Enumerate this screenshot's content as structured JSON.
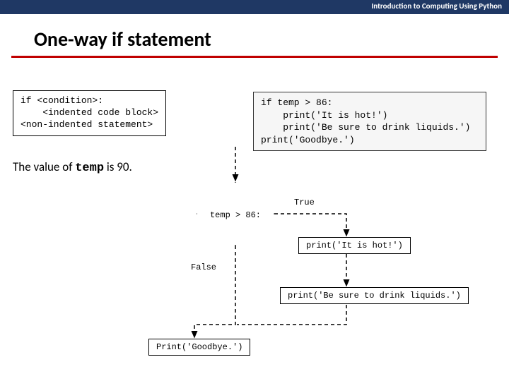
{
  "header": {
    "course": "Introduction to Computing Using Python"
  },
  "title": "One-way if statement",
  "syntax_box": "if <condition>:\n    <indented code block>\n<non-indented statement>",
  "code_box": "if temp > 86:\n    print('It is hot!')\n    print('Be sure to drink liquids.')\nprint('Goodbye.')",
  "value_sentence": {
    "prefix": "The value of ",
    "var": "temp",
    "suffix": " is 90."
  },
  "flowchart": {
    "condition": "temp > 86:",
    "true_label": "True",
    "false_label": "False",
    "box_hot": "print('It is hot!')",
    "box_drink": "print('Be sure to drink liquids.')",
    "box_goodbye": "Print('Goodbye.')"
  }
}
